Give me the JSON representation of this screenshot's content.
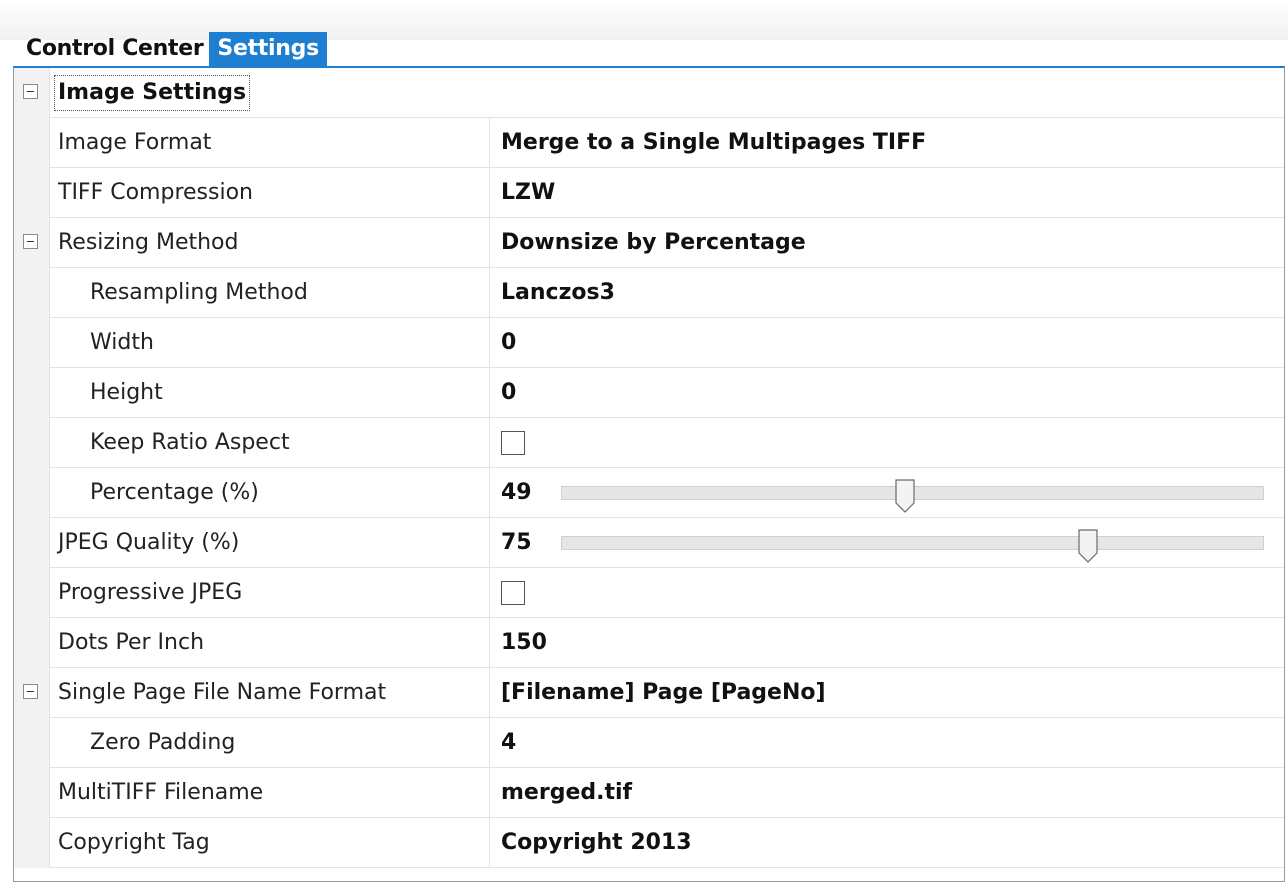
{
  "tabs": [
    {
      "label": "Control Center",
      "active": false
    },
    {
      "label": "Settings",
      "active": true
    }
  ],
  "category": {
    "label": "Image Settings",
    "expanded": true
  },
  "properties": {
    "image_format": {
      "label": "Image Format",
      "value": "Merge to a Single Multipages TIFF"
    },
    "tiff_compression": {
      "label": "TIFF Compression",
      "value": "LZW"
    },
    "resizing_method": {
      "label": "Resizing Method",
      "value": "Downsize by Percentage",
      "expanded": true
    },
    "resampling_method": {
      "label": "Resampling Method",
      "value": "Lanczos3"
    },
    "width": {
      "label": "Width",
      "value": "0"
    },
    "height": {
      "label": "Height",
      "value": "0"
    },
    "keep_ratio_aspect": {
      "label": "Keep Ratio Aspect",
      "checked": false
    },
    "percentage": {
      "label": "Percentage (%)",
      "value": "49",
      "level": 0.49
    },
    "jpeg_quality": {
      "label": "JPEG Quality (%)",
      "value": "75",
      "level": 0.75
    },
    "progressive_jpeg": {
      "label": "Progressive JPEG",
      "checked": false
    },
    "dots_per_inch": {
      "label": "Dots Per Inch",
      "value": "150"
    },
    "single_page_file_name_format": {
      "label": "Single Page File Name Format",
      "value": "[Filename] Page [PageNo]",
      "expanded": true
    },
    "zero_padding": {
      "label": "Zero Padding",
      "value": "4"
    },
    "multitiff_filename": {
      "label": "MultiTIFF Filename",
      "value": "merged.tif"
    },
    "copyright_tag": {
      "label": "Copyright Tag",
      "value": "Copyright 2013"
    }
  },
  "colors": {
    "accent": "#1e7ecf",
    "gutter": "#f2f2f2",
    "grid_line": "#e3e3e3"
  },
  "icons": {
    "expander": "collapse-minus-icon",
    "slider_thumb": "slider-thumb-icon"
  }
}
